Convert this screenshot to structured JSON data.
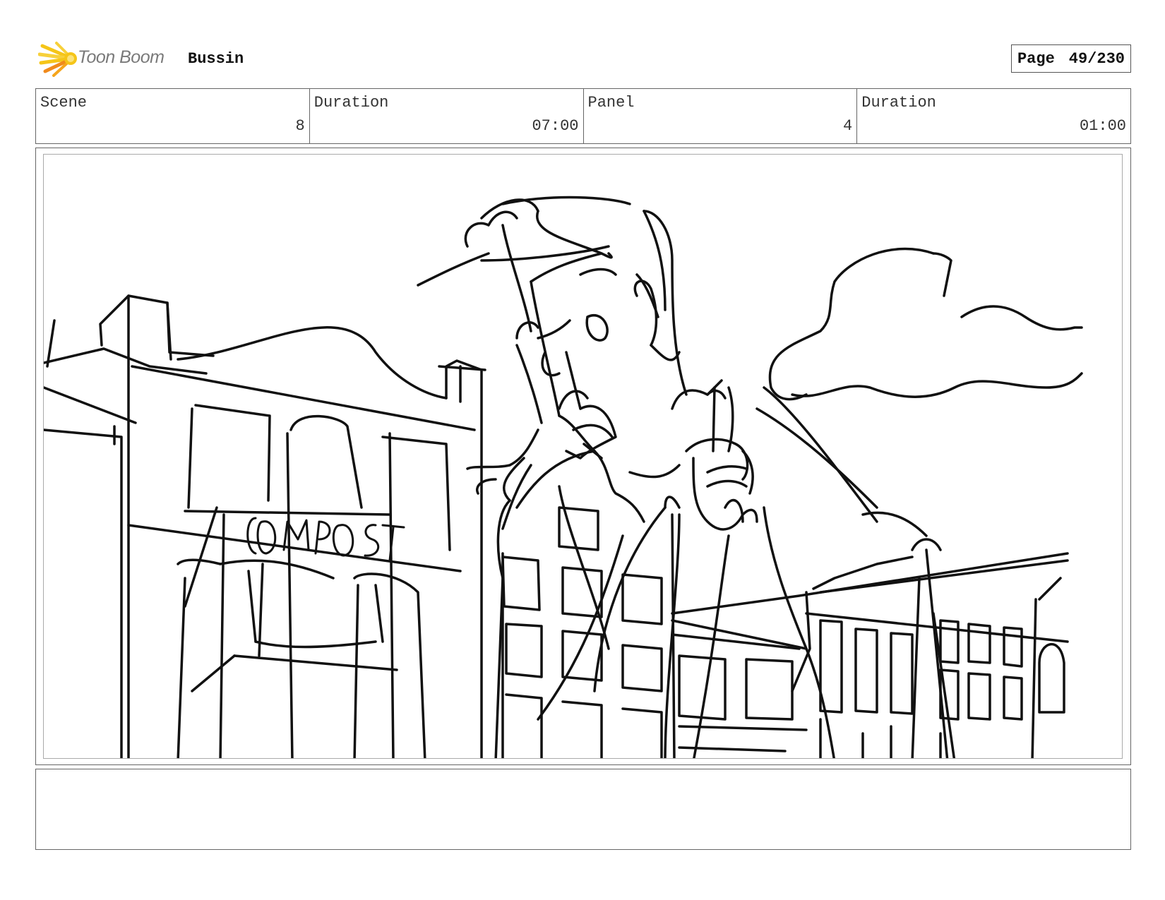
{
  "header": {
    "logo_text": "Toon Boom",
    "logo_icon": "toon-boom-starburst-icon",
    "project_title": "Bussin",
    "page_label": "Page",
    "page_value": "49/230"
  },
  "info": {
    "scene_label": "Scene",
    "scene_value": "8",
    "scene_duration_label": "Duration",
    "scene_duration_value": "07:00",
    "panel_label": "Panel",
    "panel_value": "4",
    "panel_duration_label": "Duration",
    "panel_duration_value": "01:00"
  },
  "panel": {
    "sign_text": "COMPOST"
  },
  "colors": {
    "logo_yellow": "#f5c518",
    "logo_orange": "#f08a1c",
    "border": "#666666",
    "sketch_line": "#111111"
  }
}
